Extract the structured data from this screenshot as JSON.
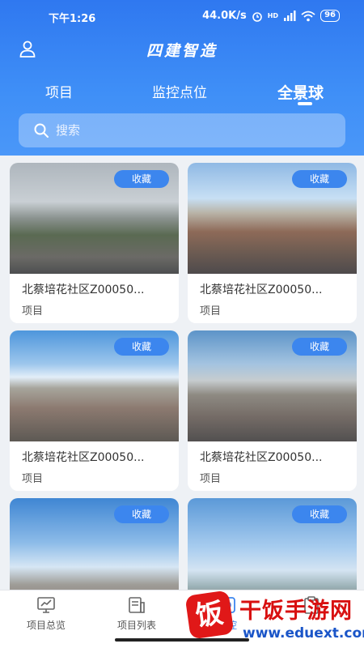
{
  "status_bar": {
    "time": "下午1:26",
    "network_speed": "44.0K/s",
    "signal": "HD",
    "battery": "96"
  },
  "header": {
    "title": "四建智造",
    "tabs": [
      {
        "label": "项目",
        "active": false
      },
      {
        "label": "监控点位",
        "active": false
      },
      {
        "label": "全景球",
        "active": true
      }
    ],
    "search_placeholder": "搜索"
  },
  "cards": [
    {
      "title": "北蔡培花社区Z00050...",
      "subtitle": "项目",
      "fav_label": "收藏"
    },
    {
      "title": "北蔡培花社区Z00050...",
      "subtitle": "项目",
      "fav_label": "收藏"
    },
    {
      "title": "北蔡培花社区Z00050...",
      "subtitle": "项目",
      "fav_label": "收藏"
    },
    {
      "title": "北蔡培花社区Z00050...",
      "subtitle": "项目",
      "fav_label": "收藏"
    },
    {
      "title": "",
      "subtitle": "",
      "fav_label": "收藏"
    },
    {
      "title": "",
      "subtitle": "",
      "fav_label": "收藏"
    }
  ],
  "bottom_nav": [
    {
      "label": "项目总览",
      "icon": "monitor-chart-icon"
    },
    {
      "label": "项目列表",
      "icon": "document-list-icon"
    },
    {
      "label": "监控",
      "icon": "camera-icon"
    },
    {
      "label": "",
      "icon": "clipboard-icon"
    }
  ],
  "watermark": {
    "logo_char": "饭",
    "name": "干饭手游网",
    "url": "www.eduext.com"
  },
  "colors": {
    "primary": "#3c86ee",
    "header_gradient_top": "#2f78f0",
    "watermark_red": "#d81010"
  }
}
